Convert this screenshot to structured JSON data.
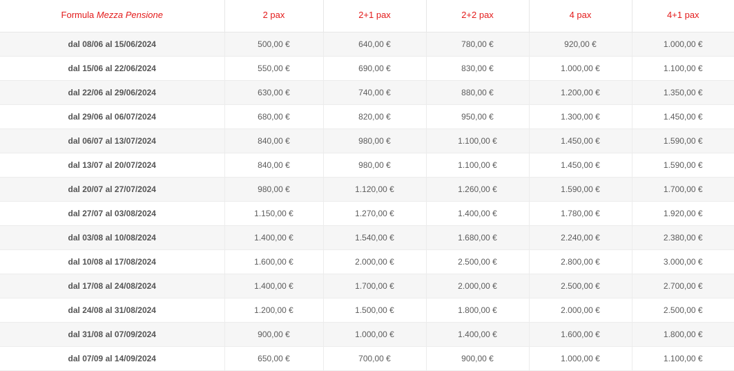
{
  "header": {
    "formula_prefix": "Formula",
    "formula_name": "Mezza Pensione",
    "columns": [
      "2 pax",
      "2+1 pax",
      "2+2 pax",
      "4 pax",
      "4+1 pax"
    ]
  },
  "rows": [
    {
      "period": "dal 08/06 al 15/06/2024",
      "prices": [
        "500,00 €",
        "640,00 €",
        "780,00 €",
        "920,00 €",
        "1.000,00 €"
      ]
    },
    {
      "period": "dal 15/06 al 22/06/2024",
      "prices": [
        "550,00 €",
        "690,00 €",
        "830,00 €",
        "1.000,00 €",
        "1.100,00 €"
      ]
    },
    {
      "period": "dal 22/06 al 29/06/2024",
      "prices": [
        "630,00 €",
        "740,00 €",
        "880,00 €",
        "1.200,00 €",
        "1.350,00 €"
      ]
    },
    {
      "period": "dal 29/06 al 06/07/2024",
      "prices": [
        "680,00 €",
        "820,00 €",
        "950,00 €",
        "1.300,00 €",
        "1.450,00 €"
      ]
    },
    {
      "period": "dal 06/07 al 13/07/2024",
      "prices": [
        "840,00 €",
        "980,00 €",
        "1.100,00 €",
        "1.450,00 €",
        "1.590,00 €"
      ]
    },
    {
      "period": "dal 13/07 al 20/07/2024",
      "prices": [
        "840,00 €",
        "980,00 €",
        "1.100,00 €",
        "1.450,00 €",
        "1.590,00 €"
      ]
    },
    {
      "period": "dal 20/07 al 27/07/2024",
      "prices": [
        "980,00 €",
        "1.120,00 €",
        "1.260,00 €",
        "1.590,00 €",
        "1.700,00 €"
      ]
    },
    {
      "period": "dal 27/07 al 03/08/2024",
      "prices": [
        "1.150,00 €",
        "1.270,00 €",
        "1.400,00 €",
        "1.780,00 €",
        "1.920,00 €"
      ]
    },
    {
      "period": "dal 03/08 al 10/08/2024",
      "prices": [
        "1.400,00 €",
        "1.540,00 €",
        "1.680,00 €",
        "2.240,00 €",
        "2.380,00 €"
      ]
    },
    {
      "period": "dal 10/08 al 17/08/2024",
      "prices": [
        "1.600,00 €",
        "2.000,00 €",
        "2.500,00 €",
        "2.800,00 €",
        "3.000,00 €"
      ]
    },
    {
      "period": "dal 17/08 al 24/08/2024",
      "prices": [
        "1.400,00 €",
        "1.700,00 €",
        "2.000,00 €",
        "2.500,00 €",
        "2.700,00 €"
      ]
    },
    {
      "period": "dal 24/08 al 31/08/2024",
      "prices": [
        "1.200,00 €",
        "1.500,00 €",
        "1.800,00 €",
        "2.000,00 €",
        "2.500,00 €"
      ]
    },
    {
      "period": "dal 31/08 al 07/09/2024",
      "prices": [
        "900,00 €",
        "1.000,00 €",
        "1.400,00 €",
        "1.600,00 €",
        "1.800,00 €"
      ]
    },
    {
      "period": "dal 07/09 al 14/09/2024",
      "prices": [
        "650,00 €",
        "700,00 €",
        "900,00 €",
        "1.000,00 €",
        "1.100,00 €"
      ]
    }
  ]
}
